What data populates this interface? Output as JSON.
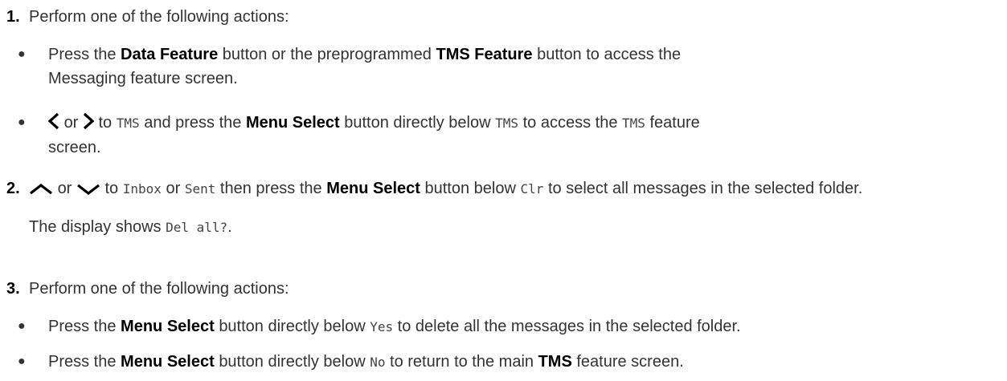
{
  "steps": [
    {
      "number": "1.",
      "text": "Perform one of the following actions:"
    },
    {
      "number": "2.",
      "text_or": "or",
      "text_to": "to",
      "text_then": "then press the",
      "inbox": "Inbox",
      "or2": "or",
      "sent": "Sent",
      "menu_select": "Menu Select",
      "button_below": "button below",
      "clr": "Clr",
      "tail": "to select all messages in the selected folder.",
      "result_pre": "The display shows",
      "result_code": "Del all?",
      "result_post": "."
    },
    {
      "number": "3.",
      "text": "Perform one of the following actions:"
    }
  ],
  "step1_subs": [
    {
      "pre": "Press the",
      "b1": "Data Feature",
      "mid": "button or the preprogrammed",
      "b2": "TMS Feature",
      "post": "button to access the",
      "line2": "Messaging feature screen."
    },
    {
      "or": "or",
      "to": "to",
      "tms1": "TMS",
      "and_press": "and press the",
      "b1": "Menu Select",
      "below": "button directly below",
      "tms2": "TMS",
      "to_access": "to access the",
      "tms3": "TMS",
      "feature": "feature",
      "line2": "screen."
    }
  ],
  "step3_subs": [
    {
      "pre": "Press the",
      "b1": "Menu Select",
      "below": "button directly below",
      "code": "Yes",
      "post": "to delete all the messages in the selected folder."
    },
    {
      "pre": "Press the",
      "b1": "Menu Select",
      "below": "button directly below",
      "code": "No",
      "post": "to return to the main",
      "b2": "TMS",
      "end": "feature screen."
    }
  ],
  "icons": [
    "left-arrow-icon",
    "right-arrow-icon",
    "up-arrow-icon",
    "down-arrow-icon",
    "bullet-icon"
  ]
}
